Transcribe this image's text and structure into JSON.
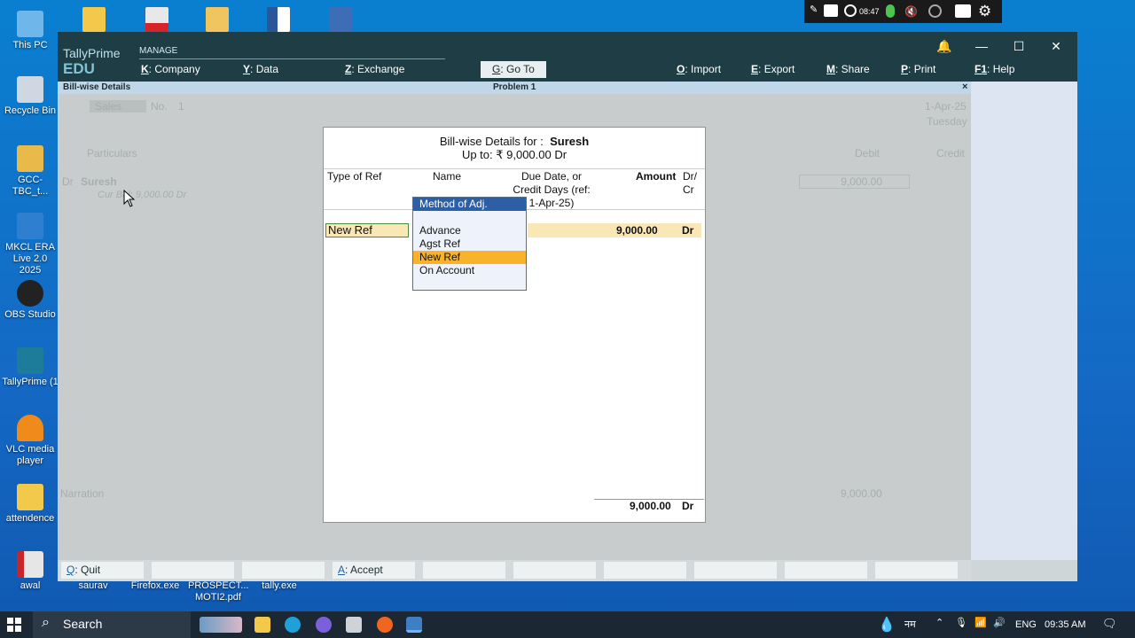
{
  "desktop": {
    "icons": [
      {
        "label": "This PC"
      },
      {
        "label": "Recycle Bin"
      },
      {
        "label": "GCC-TBC_t..."
      },
      {
        "label": "MKCL ERA Live 2.0 2025"
      },
      {
        "label": "OBS Studio"
      },
      {
        "label": "TallyPrime (1"
      },
      {
        "label": "VLC media player"
      },
      {
        "label": "attendence"
      },
      {
        "label": "awal"
      }
    ],
    "bottom_labels": [
      "saurav",
      "Firefox.exe",
      "PROSPECT... MOTI2.pdf",
      "tally.exe"
    ]
  },
  "recorder": {
    "time": "08:47"
  },
  "tally": {
    "brand_line1": "TallyPrime",
    "brand_line2": "EDU",
    "manage": "MANAGE",
    "menus": [
      {
        "key": "K",
        "label": "Company"
      },
      {
        "key": "Y",
        "label": "Data"
      },
      {
        "key": "Z",
        "label": "Exchange"
      },
      {
        "key": "G",
        "label": "Go To"
      },
      {
        "key": "O",
        "label": "Import"
      },
      {
        "key": "E",
        "label": "Export"
      },
      {
        "key": "M",
        "label": "Share"
      },
      {
        "key": "P",
        "label": "Print"
      },
      {
        "key": "F1",
        "label": "Help"
      }
    ],
    "window_title": "Bill-wise Details",
    "company_title": "Problem 1",
    "close_x": "×",
    "background": {
      "voucher_type": "Sales",
      "no_label": "No.",
      "no_value": "1",
      "date": "1-Apr-25",
      "day": "Tuesday",
      "particulars": "Particulars",
      "debit": "Debit",
      "credit": "Credit",
      "dr": "Dr",
      "party": "Suresh",
      "cur_bal": "Cur Bal: 9,000.00 Dr",
      "debit_value": "9,000.00",
      "narration": "Narration",
      "narration_total": "9,000.00"
    },
    "modal": {
      "title_prefix": "Bill-wise Details for :",
      "party": "Suresh",
      "upto": "Up to:  ₹ 9,000.00 Dr",
      "headers": {
        "type_of_ref": "Type of Ref",
        "name": "Name",
        "due_date": "Due Date, or Credit Days (ref: 1-Apr-25)",
        "amount": "Amount",
        "drcr": "Dr/ Cr"
      },
      "row": {
        "type_of_ref": "New Ref",
        "amount": "9,000.00",
        "drcr": "Dr"
      },
      "total": {
        "amount": "9,000.00",
        "drcr": "Dr"
      }
    },
    "popup": {
      "title": "Method of Adj.",
      "items": [
        "Advance",
        "Agst Ref",
        "New Ref",
        "On Account"
      ],
      "selected": "New Ref"
    },
    "buttons": [
      {
        "key": "Q",
        "label": "Quit"
      },
      {
        "key": "A",
        "label": "Accept"
      }
    ]
  },
  "taskbar": {
    "search": "Search",
    "lang_hint": "नम",
    "lang": "ENG",
    "time": "09:35 AM"
  }
}
